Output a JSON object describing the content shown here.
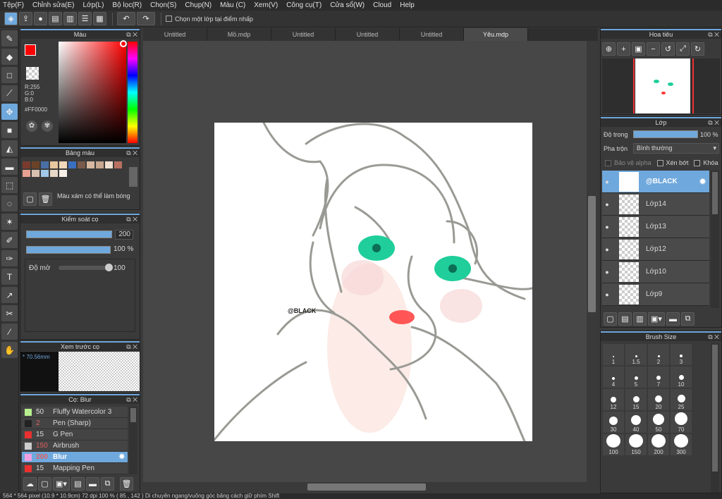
{
  "menu": [
    "Tệp(F)",
    "Chỉnh sửa(E)",
    "Lớp(L)",
    "Bộ lọc(R)",
    "Chọn(S)",
    "Chụp(N)",
    "Màu (C)",
    "Xem(V)",
    "Công cụ(T)",
    "Cửa sổ(W)",
    "Cloud",
    "Help"
  ],
  "toolbar": {
    "snap_label": "Chọn một lớp tại điểm nhấp"
  },
  "color_panel": {
    "title": "Màu",
    "r": "R:255",
    "g": "G:0",
    "b": "B:0",
    "hex": "#FF0000",
    "current": "#ff0000"
  },
  "palette_panel": {
    "title": "Bảng màu",
    "hint": "Màu xám có thể làm bóng",
    "colors": [
      "#7a3b2e",
      "#6b4226",
      "#4a6fa5",
      "#e8c8a0",
      "#f0d8b8",
      "#3a6fc0",
      "#7a5a4a",
      "#d8b8a0",
      "#c8a890",
      "#f0e0d0",
      "#b87060",
      "#e8a090",
      "#d8c0b0",
      "#a0c8e8",
      "#e8d8c8",
      "#f8f0e8"
    ]
  },
  "brush_control": {
    "title": "Kiểm soát cọ",
    "size": "200",
    "opacity": "100 %",
    "blur_label": "Độ mờ",
    "blur_value": "100",
    "size_fill": 1.0,
    "opacity_fill": 1.0,
    "blur_fill": 1.0
  },
  "brush_preview": {
    "title": "Xem trước cọ",
    "size_text": "* 70.56mm"
  },
  "brush_list": {
    "title": "Cọ: Blur",
    "items": [
      {
        "size": "50",
        "name": "Fluffy Watercolor 3",
        "color": "#b8f090"
      },
      {
        "size": "2",
        "name": "Pen (Sharp)",
        "color": "#222222"
      },
      {
        "size": "15",
        "name": "G Pen",
        "color": "#e83030"
      },
      {
        "size": "150",
        "name": "Airbrush",
        "color": "#cccccc"
      },
      {
        "size": "200",
        "name": "Blur",
        "color": "#f0a0e0"
      },
      {
        "size": "15",
        "name": "Mapping Pen",
        "color": "#e83030"
      }
    ]
  },
  "tabs": [
    "Untitled",
    "Mồ.mdp",
    "Untitled",
    "Untitled",
    "Untitled",
    "Yêu.mdp"
  ],
  "canvas": {
    "watermark": "@BLACK"
  },
  "navigator": {
    "title": "Hoa tiêu"
  },
  "layers": {
    "title": "Lớp",
    "opacity_label": "Độ trong",
    "opacity_value": "100 %",
    "blend_label": "Pha trộn",
    "blend_value": "Bình thường",
    "protect_alpha": "Bảo vệ alpha",
    "clipping": "Xén bớt",
    "lock": "Khóa",
    "items": [
      "@BLACK",
      "Lớp14",
      "Lớp13",
      "Lớp12",
      "Lớp10",
      "Lớp9"
    ]
  },
  "brush_size": {
    "title": "Brush Size",
    "sizes": [
      "1",
      "1.5",
      "2",
      "3",
      "4",
      "5",
      "7",
      "10",
      "12",
      "15",
      "20",
      "25",
      "30",
      "40",
      "50",
      "70",
      "100",
      "150",
      "200",
      "300"
    ]
  },
  "status": {
    "text": "564 * 564 pixel   (10.9 * 10.9cm)   72 dpi   100 %   ( 85 , 142 )   Di chuyển ngang/vuông góc bằng cách giữ phím Shift"
  }
}
